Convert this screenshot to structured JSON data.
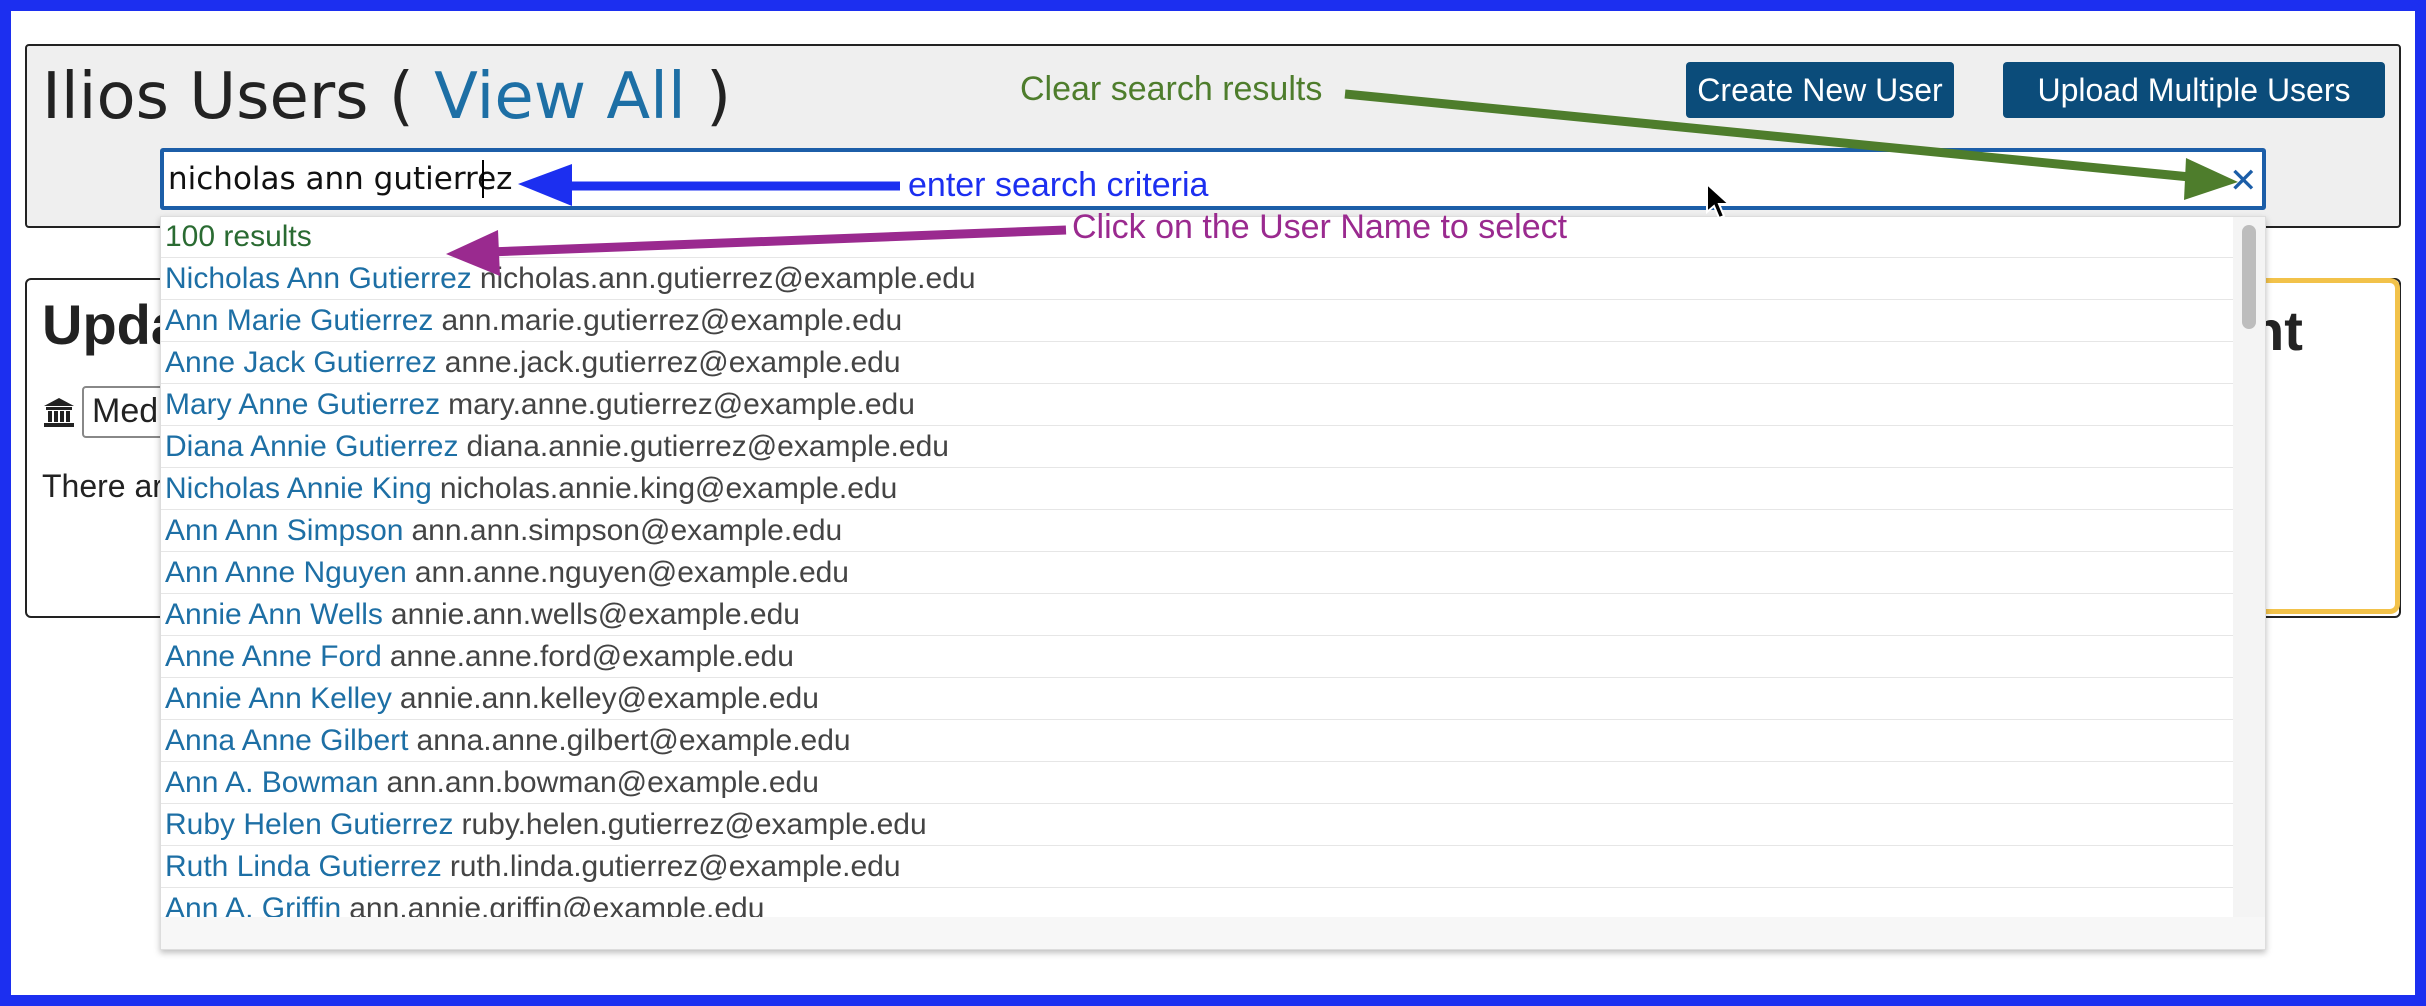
{
  "header": {
    "title_prefix": "Ilios Users ( ",
    "view_all_link": "View All",
    "title_suffix": " )",
    "create_user_button": "Create New User",
    "upload_users_button": "Upload Multiple Users"
  },
  "search": {
    "value": "nicholas ann gutierrez",
    "clear_glyph": "✕",
    "results_count": "100 results",
    "results": [
      {
        "name": "Nicholas Ann Gutierrez",
        "email": "nicholas.ann.gutierrez@example.edu"
      },
      {
        "name": "Ann Marie Gutierrez",
        "email": "ann.marie.gutierrez@example.edu"
      },
      {
        "name": "Anne Jack Gutierrez",
        "email": "anne.jack.gutierrez@example.edu"
      },
      {
        "name": "Mary Anne Gutierrez",
        "email": "mary.anne.gutierrez@example.edu"
      },
      {
        "name": "Diana Annie Gutierrez",
        "email": "diana.annie.gutierrez@example.edu"
      },
      {
        "name": "Nicholas Annie King",
        "email": "nicholas.annie.king@example.edu"
      },
      {
        "name": "Ann Ann Simpson",
        "email": "ann.ann.simpson@example.edu"
      },
      {
        "name": "Ann Anne Nguyen",
        "email": "ann.anne.nguyen@example.edu"
      },
      {
        "name": "Annie Ann Wells",
        "email": "annie.ann.wells@example.edu"
      },
      {
        "name": "Anne Anne Ford",
        "email": "anne.anne.ford@example.edu"
      },
      {
        "name": "Annie Ann Kelley",
        "email": "annie.ann.kelley@example.edu"
      },
      {
        "name": "Anna Anne Gilbert",
        "email": "anna.anne.gilbert@example.edu"
      },
      {
        "name": "Ann A. Bowman",
        "email": "ann.ann.bowman@example.edu"
      },
      {
        "name": "Ruby Helen Gutierrez",
        "email": "ruby.helen.gutierrez@example.edu"
      },
      {
        "name": "Ruth Linda Gutierrez",
        "email": "ruth.linda.gutierrez@example.edu"
      },
      {
        "name": "Ann A. Griffin",
        "email": "ann.annie.griffin@example.edu"
      }
    ]
  },
  "update_panel": {
    "title_start": "Upda",
    "title_end": "nt",
    "school_value": "Medi",
    "text": "There ar"
  },
  "annotations": {
    "clear": "Clear search results",
    "search": "enter search criteria",
    "click": "Click on the User Name to select"
  },
  "colors": {
    "frame": "#1c2ff0",
    "button": "#0b4c7a",
    "link": "#1d6fa5",
    "clear_arrow": "#4e7d2c",
    "search_arrow": "#1c2ff0",
    "click_arrow": "#9a2a8f",
    "highlight": "#f2c24a"
  },
  "icons": {
    "school": "university-icon",
    "clear": "close-icon",
    "cursor": "mouse-pointer-icon"
  }
}
